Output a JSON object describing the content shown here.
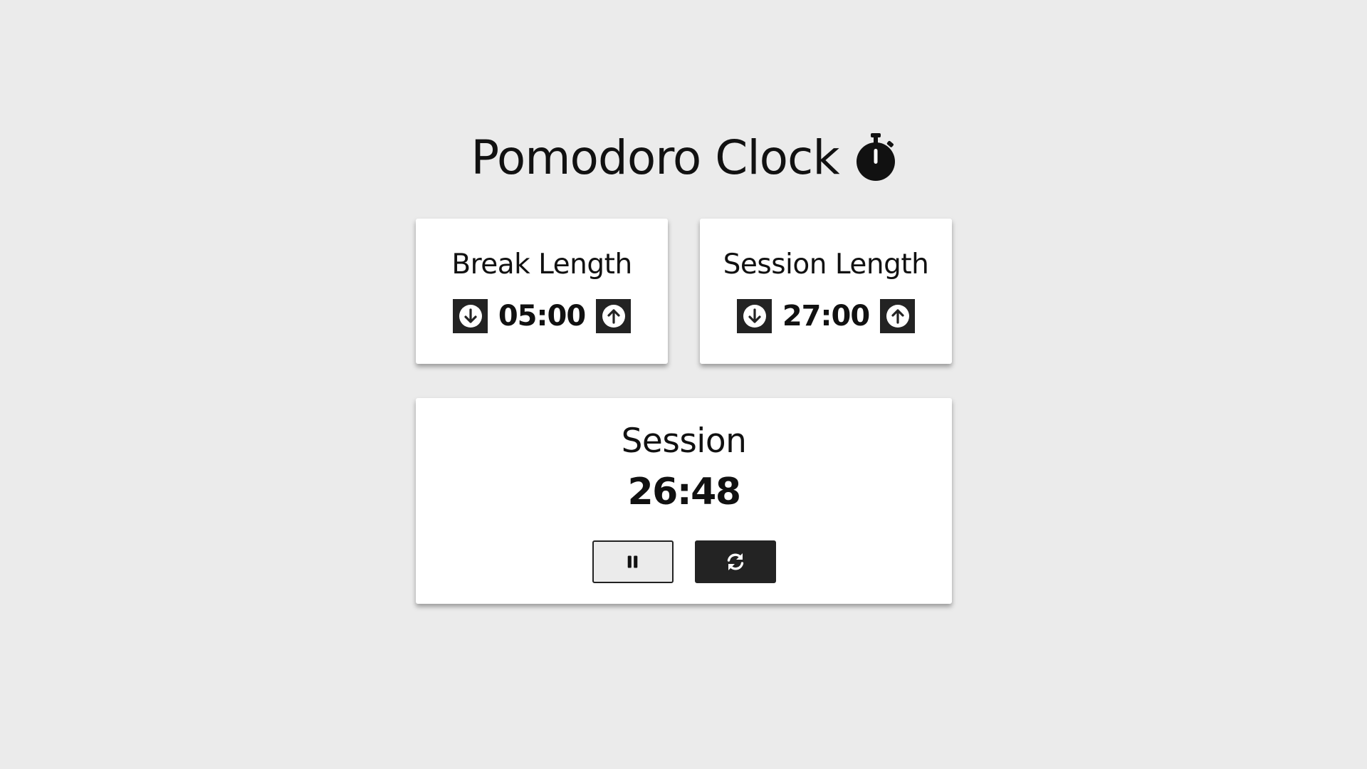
{
  "header": {
    "title": "Pomodoro Clock",
    "icon": "stopwatch-icon"
  },
  "break_length": {
    "label": "Break Length",
    "value": "05:00",
    "decrement_icon": "arrow-down-circle-icon",
    "increment_icon": "arrow-up-circle-icon"
  },
  "session_length": {
    "label": "Session Length",
    "value": "27:00",
    "decrement_icon": "arrow-down-circle-icon",
    "increment_icon": "arrow-up-circle-icon"
  },
  "timer": {
    "label": "Session",
    "time": "26:48",
    "pause_icon": "pause-icon",
    "reset_icon": "refresh-icon"
  },
  "colors": {
    "background": "#ebebeb",
    "card": "#ffffff",
    "button_dark": "#232323",
    "text": "#111111"
  }
}
